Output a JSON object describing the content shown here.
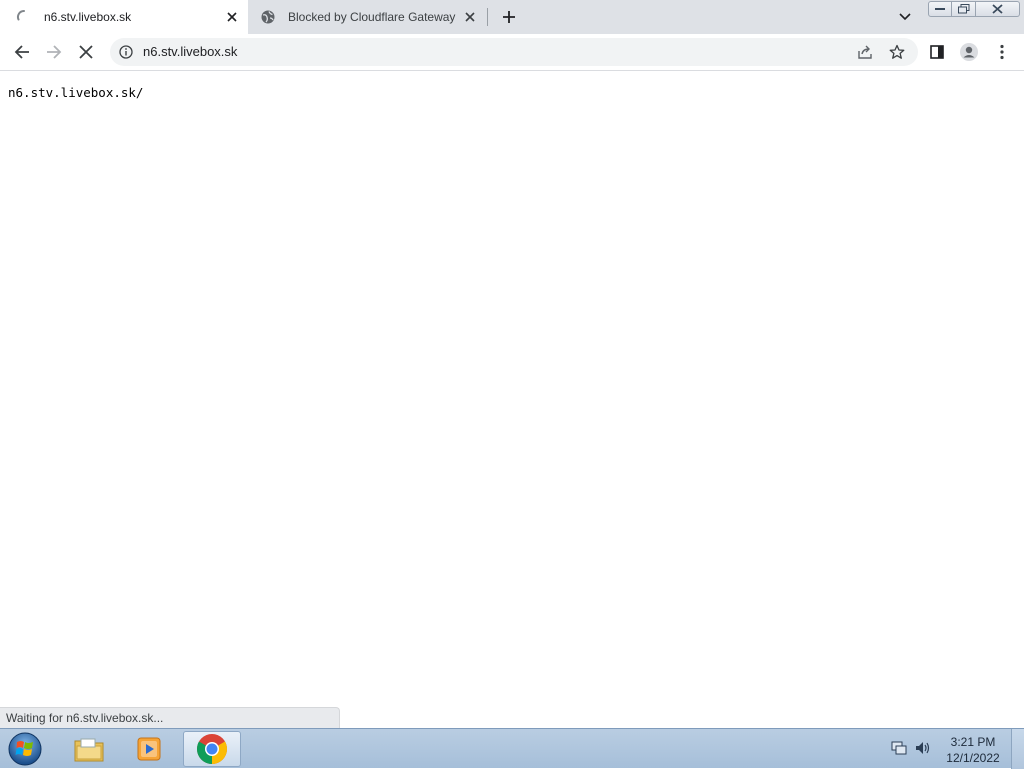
{
  "tabs": [
    {
      "title": "n6.stv.livebox.sk",
      "active": true,
      "icon": "loading-spinner-icon"
    },
    {
      "title": "Blocked by Cloudflare Gateway",
      "active": false,
      "icon": "globe-icon"
    }
  ],
  "toolbar": {
    "url": "n6.stv.livebox.sk",
    "back_icon": "back-arrow-icon",
    "forward_icon": "forward-arrow-icon",
    "stop_icon": "stop-icon"
  },
  "page": {
    "text": "n6.stv.livebox.sk/"
  },
  "status": {
    "text": "Waiting for n6.stv.livebox.sk..."
  },
  "taskbar": {
    "time": "3:21 PM",
    "date": "12/1/2022",
    "items": [
      "file-explorer-icon",
      "media-player-icon",
      "chrome-icon"
    ]
  },
  "colors": {
    "tabstrip_bg": "#dee1e6",
    "omnibox_bg": "#f1f3f4",
    "taskbar_bg": "#b9cde2"
  }
}
